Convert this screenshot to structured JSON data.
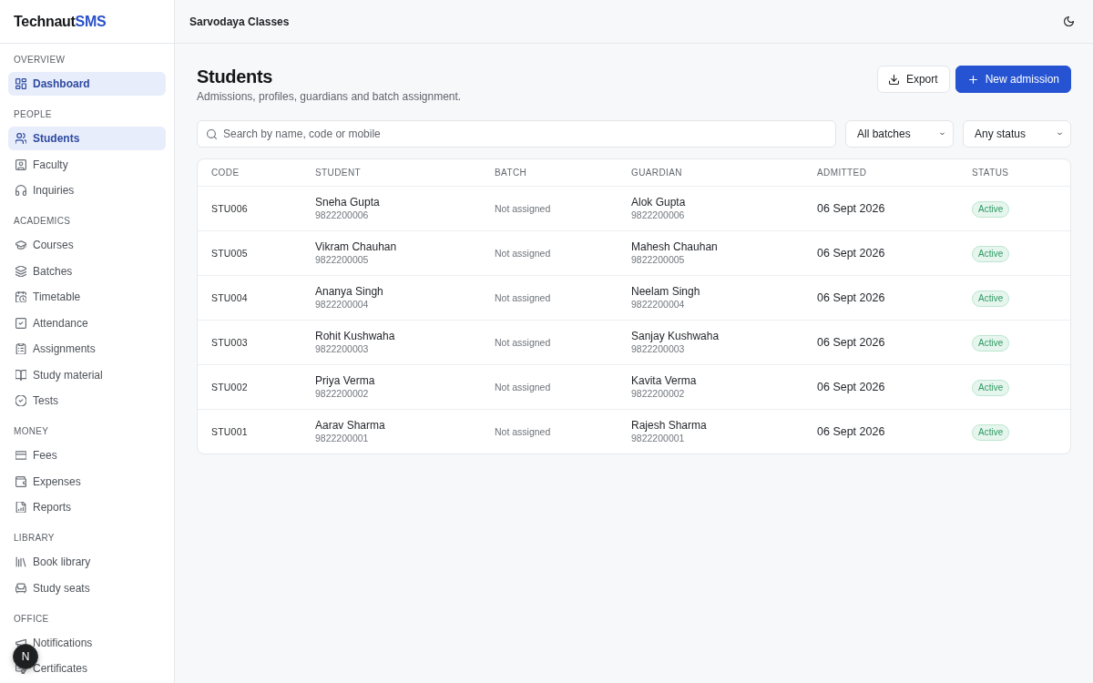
{
  "sidebar": {
    "logo": {
      "text": "Technaut",
      "accent": "SMS"
    },
    "sections": [
      {
        "label": "OVERVIEW",
        "items": [
          {
            "label": "Dashboard",
            "selected": true
          }
        ]
      },
      {
        "label": "PEOPLE",
        "items": [
          {
            "label": "Students",
            "selected": true
          },
          {
            "label": "Faculty",
            "selected": false
          },
          {
            "label": "Inquiries",
            "selected": false
          }
        ]
      },
      {
        "label": "ACADEMICS",
        "items": [
          {
            "label": "Courses",
            "selected": false
          },
          {
            "label": "Batches",
            "selected": false
          },
          {
            "label": "Timetable",
            "selected": false
          },
          {
            "label": "Attendance",
            "selected": false
          },
          {
            "label": "Assignments",
            "selected": false
          },
          {
            "label": "Study material",
            "selected": false
          },
          {
            "label": "Tests",
            "selected": false
          }
        ]
      },
      {
        "label": "MONEY",
        "items": [
          {
            "label": "Fees",
            "selected": false
          },
          {
            "label": "Expenses",
            "selected": false
          },
          {
            "label": "Reports",
            "selected": false
          }
        ]
      },
      {
        "label": "LIBRARY",
        "items": [
          {
            "label": "Book library",
            "selected": false
          },
          {
            "label": "Study seats",
            "selected": false
          }
        ]
      },
      {
        "label": "OFFICE",
        "items": [
          {
            "label": "Notifications",
            "selected": false
          },
          {
            "label": "Certificates",
            "selected": false
          }
        ]
      }
    ]
  },
  "topbar": {
    "org_name": "Sarvodaya Classes"
  },
  "page": {
    "title": "Students",
    "subtitle": "Admissions, profiles, guardians and batch assignment.",
    "actions": [
      {
        "label": "Export",
        "kind": "secondary"
      },
      {
        "label": "New admission",
        "kind": "primary"
      }
    ]
  },
  "filters": {
    "search": {
      "placeholder": "Search by name, code or mobile"
    },
    "selects": [
      {
        "value": "All batches"
      },
      {
        "value": "Any status"
      }
    ]
  },
  "table": {
    "columns": [
      "CODE",
      "STUDENT",
      "BATCH",
      "GUARDIAN",
      "ADMITTED",
      "STATUS"
    ],
    "rows": [
      {
        "code": "STU006",
        "student": "Sneha Gupta",
        "student_mobile": "9822200006",
        "batch": "Not assigned",
        "guardian": "Alok Gupta",
        "guardian_mobile": "9822200006",
        "admitted": "06 Sept 2026",
        "status": "Active"
      },
      {
        "code": "STU005",
        "student": "Vikram Chauhan",
        "student_mobile": "9822200005",
        "batch": "Not assigned",
        "guardian": "Mahesh Chauhan",
        "guardian_mobile": "9822200005",
        "admitted": "06 Sept 2026",
        "status": "Active"
      },
      {
        "code": "STU004",
        "student": "Ananya Singh",
        "student_mobile": "9822200004",
        "batch": "Not assigned",
        "guardian": "Neelam Singh",
        "guardian_mobile": "9822200004",
        "admitted": "06 Sept 2026",
        "status": "Active"
      },
      {
        "code": "STU003",
        "student": "Rohit Kushwaha",
        "student_mobile": "9822200003",
        "batch": "Not assigned",
        "guardian": "Sanjay Kushwaha",
        "guardian_mobile": "9822200003",
        "admitted": "06 Sept 2026",
        "status": "Active"
      },
      {
        "code": "STU002",
        "student": "Priya Verma",
        "student_mobile": "9822200002",
        "batch": "Not assigned",
        "guardian": "Kavita Verma",
        "guardian_mobile": "9822200002",
        "admitted": "06 Sept 2026",
        "status": "Active"
      },
      {
        "code": "STU001",
        "student": "Aarav Sharma",
        "student_mobile": "9822200001",
        "batch": "Not assigned",
        "guardian": "Rajesh Sharma",
        "guardian_mobile": "9822200001",
        "admitted": "06 Sept 2026",
        "status": "Active"
      }
    ]
  },
  "dev_badge": {
    "label": "N"
  }
}
